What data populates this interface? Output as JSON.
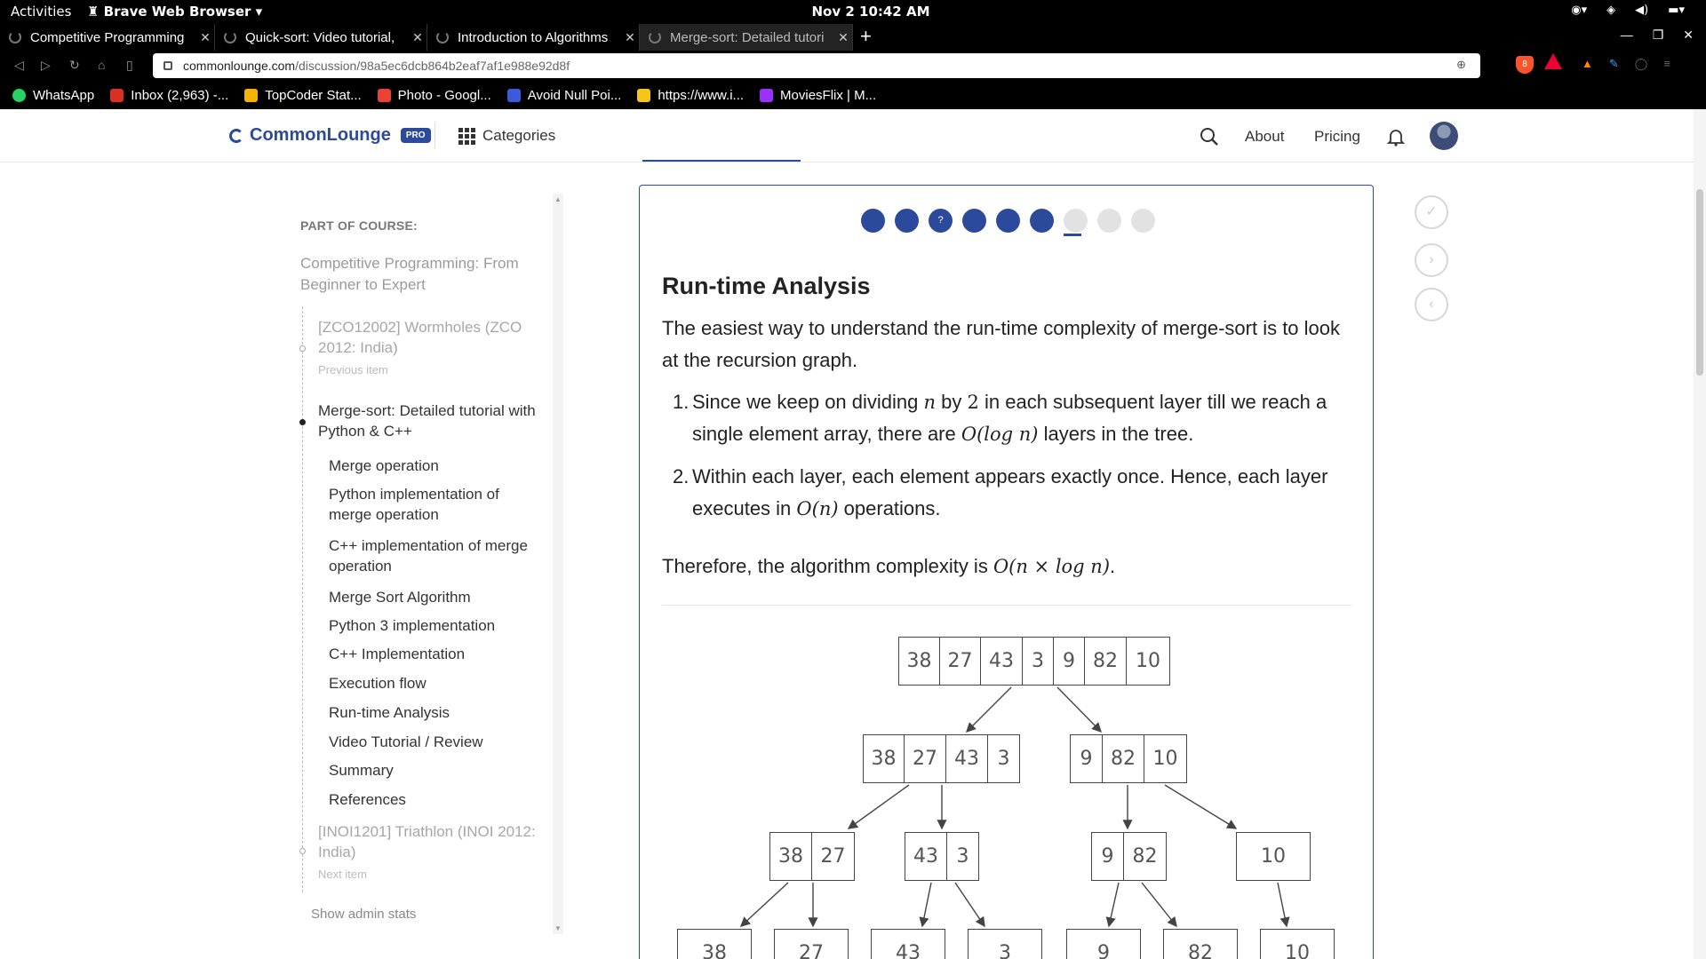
{
  "system_bar": {
    "activities": "Activities",
    "app_menu": "Brave Web Browser",
    "clock": "Nov 2  10:42 AM"
  },
  "tabs": [
    {
      "title": "Competitive Programming"
    },
    {
      "title": "Quick-sort: Video tutorial,"
    },
    {
      "title": "Introduction to Algorithms"
    },
    {
      "title": "Merge-sort: Detailed tutori"
    }
  ],
  "address_bar": {
    "host": "commonlounge.com",
    "path": "/discussion/98a5ec6dcb864b2eaf7af1e988e92d8f",
    "shields_count": "8"
  },
  "bookmarks": [
    {
      "label": "WhatsApp",
      "color": "#25d366"
    },
    {
      "label": "Inbox (2,963) -...",
      "color": "#d93025"
    },
    {
      "label": "TopCoder Stat...",
      "color": "#f4b400"
    },
    {
      "label": "Photo - Googl...",
      "color": "#ea4335"
    },
    {
      "label": "Avoid Null Poi...",
      "color": "#3b5bdb"
    },
    {
      "label": "https://www.i...",
      "color": "#f5c518"
    },
    {
      "label": "MoviesFlix | M...",
      "color": "#9b30ff"
    }
  ],
  "site_header": {
    "logo": "CommonLounge",
    "pro_badge": "PRO",
    "categories": "Categories",
    "about": "About",
    "pricing": "Pricing"
  },
  "sidebar": {
    "heading": "PART OF COURSE:",
    "course": "Competitive Programming: From Beginner to Expert",
    "previous_item": "[ZCO12002] Wormholes (ZCO 2012: India)",
    "previous_label": "Previous item",
    "current_item": "Merge-sort: Detailed tutorial with Python & C++",
    "sections": [
      "Merge operation",
      "Python implementation of merge operation",
      "C++ implementation of merge operation",
      "Merge Sort Algorithm",
      "Python 3 implementation",
      "C++ Implementation",
      "Execution flow",
      "Run-time Analysis",
      "Video Tutorial / Review",
      "Summary",
      "References"
    ],
    "next_item": "[INOI1201] Triathlon (INOI 2012: India)",
    "next_label": "Next item",
    "admin": "Show admin stats"
  },
  "progress": {
    "dots": [
      "",
      "",
      "?",
      "",
      "",
      "",
      "",
      "",
      ""
    ],
    "completed": 6,
    "current": 7
  },
  "content": {
    "title": "Run-time Analysis",
    "intro": "The easiest way to understand the run-time complexity of merge-sort is to look at the recursion graph.",
    "item1_a": "Since we keep on dividing ",
    "item1_n": "n",
    "item1_b": " by ",
    "item1_two": "2",
    "item1_c": " in each subsequent layer till we reach a single element array, there are ",
    "item1_math": "O(log n)",
    "item1_d": " layers in the tree.",
    "item2_a": "Within each layer, each element appears exactly once. Hence, each layer executes in ",
    "item2_math": "O(n)",
    "item2_b": " operations.",
    "conclusion_a": "Therefore, the algorithm complexity is ",
    "conclusion_math": "O(n × log n)",
    "conclusion_b": "."
  },
  "tree": {
    "level0": [
      "38",
      "27",
      "43",
      "3",
      "9",
      "82",
      "10"
    ],
    "level1_left": [
      "38",
      "27",
      "43",
      "3"
    ],
    "level1_right": [
      "9",
      "82",
      "10"
    ],
    "level2": [
      [
        "38",
        "27"
      ],
      [
        "43",
        "3"
      ],
      [
        "9",
        "82"
      ],
      [
        "10"
      ]
    ],
    "level3": [
      "38",
      "27",
      "43",
      "3",
      "9",
      "82",
      "10"
    ]
  }
}
